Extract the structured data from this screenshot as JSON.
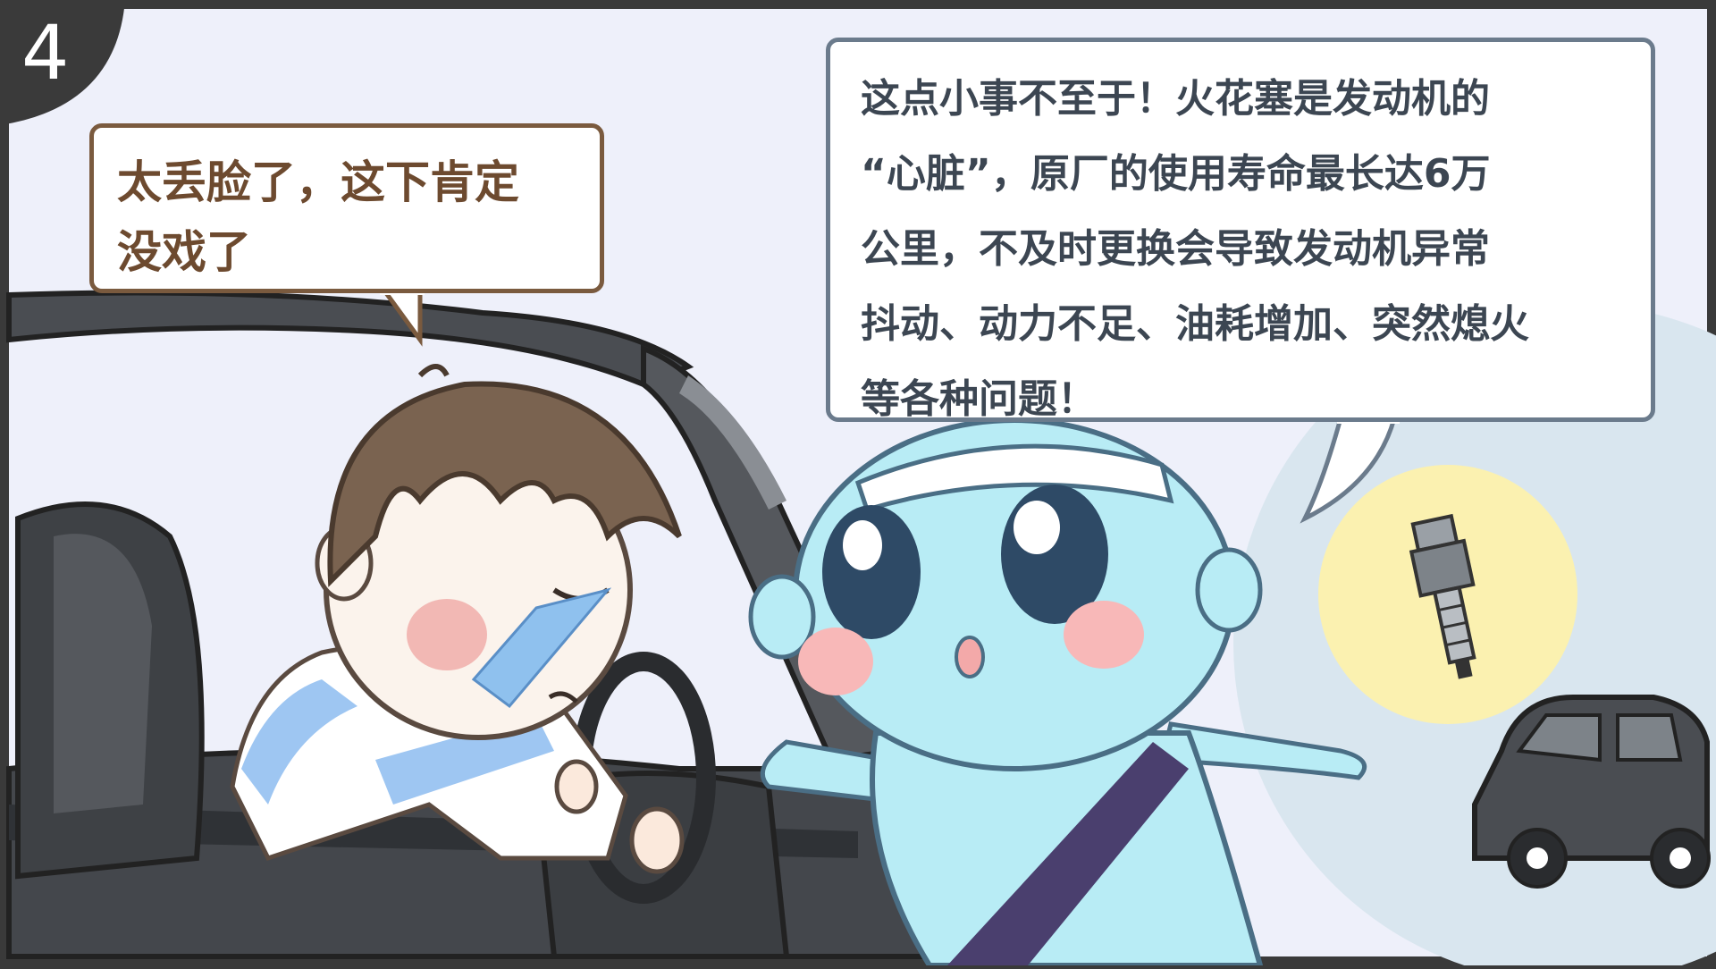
{
  "panel_number": "4",
  "bubbles": {
    "left": {
      "lines": [
        "太丢脸了，这下肯定",
        "没戏了"
      ]
    },
    "right": {
      "lines": [
        "这点小事不至于！火花塞是发动机的",
        "“心脏”，原厂的使用寿命最长达6万",
        "公里，不及时更换会导致发动机异常",
        "抖动、动力不足、油耗增加、突然熄火",
        "等各种问题！"
      ]
    }
  },
  "colors": {
    "background": "#eef0fa",
    "frame": "#3a3a3a",
    "car_body": "#4a4d52",
    "mascot_skin": "#b8ecf5",
    "sash": "#4a3f6e",
    "hair": "#7a6350",
    "highlight_circle": "#fbf1b0"
  },
  "icons": [
    "spark-plug-icon",
    "car-icon"
  ]
}
